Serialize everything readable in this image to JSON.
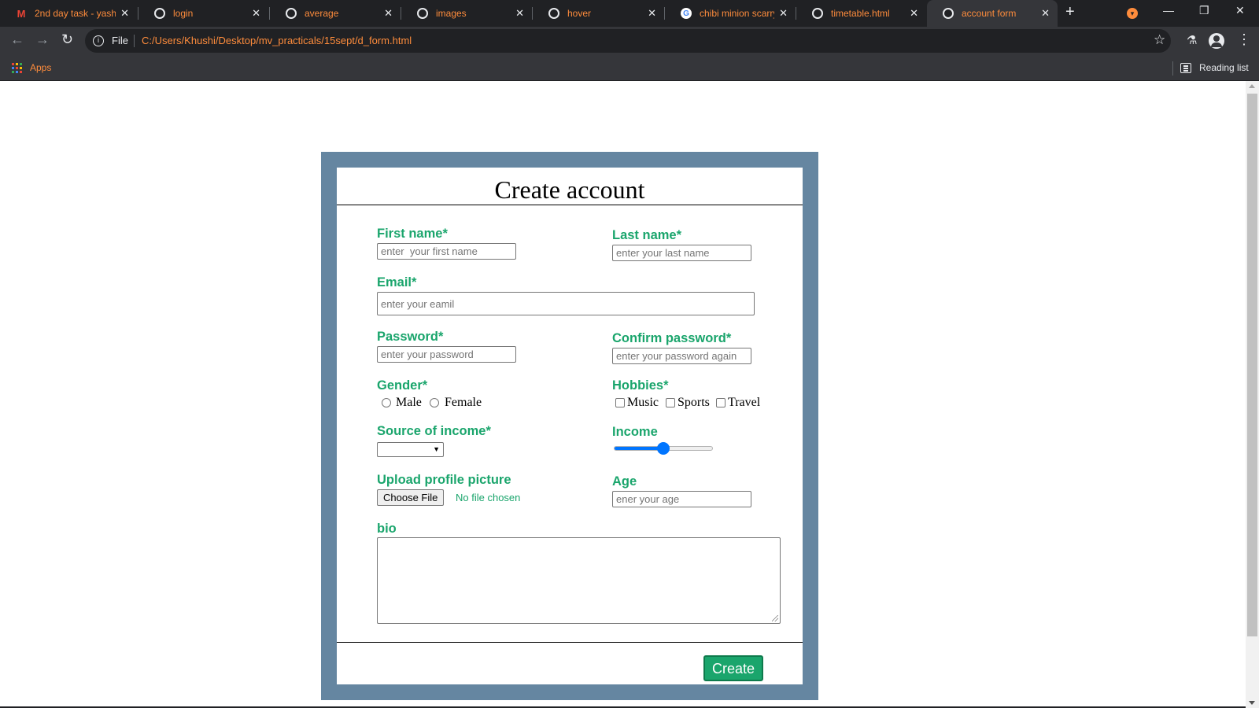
{
  "browser": {
    "tabs": [
      {
        "title": "2nd day task - yash",
        "icon": "gmail-icon"
      },
      {
        "title": "login",
        "icon": "globe-icon"
      },
      {
        "title": "average",
        "icon": "globe-icon"
      },
      {
        "title": "images",
        "icon": "globe-icon"
      },
      {
        "title": "hover",
        "icon": "globe-icon"
      },
      {
        "title": "chibi minion scarry",
        "icon": "google-icon"
      },
      {
        "title": "timetable.html",
        "icon": "globe-icon"
      },
      {
        "title": "account form",
        "icon": "globe-icon",
        "active": true
      }
    ],
    "address": {
      "scheme": "File",
      "url": "C:/Users/Khushi/Desktop/mv_practicals/15sept/d_form.html"
    },
    "bookmarks": {
      "apps_label": "Apps",
      "reading_list_label": "Reading list"
    },
    "accent_color": "#fe8c3c"
  },
  "form": {
    "title": "Create account",
    "label_color": "#1aa56c",
    "frame_color": "#6586a1",
    "first_name": {
      "label": "First name*",
      "placeholder": "enter  your first name"
    },
    "last_name": {
      "label": "Last name*",
      "placeholder": "enter your last name"
    },
    "email": {
      "label": "Email*",
      "placeholder": "enter your eamil"
    },
    "password": {
      "label": "Password*",
      "placeholder": "enter your password"
    },
    "confirm_password": {
      "label": "Confirm password*",
      "placeholder": "enter your password again"
    },
    "gender": {
      "label": "Gender*",
      "options": [
        "Male",
        "Female"
      ]
    },
    "hobbies": {
      "label": "Hobbies*",
      "options": [
        "Music",
        "Sports",
        "Travel"
      ]
    },
    "source_of_income": {
      "label": "Source of income*",
      "selected": ""
    },
    "income": {
      "label": "Income",
      "value_fraction": 0.5
    },
    "upload": {
      "label": "Upload profile picture",
      "button": "Choose File",
      "status": "No file chosen"
    },
    "age": {
      "label": "Age",
      "placeholder": "ener your age"
    },
    "bio": {
      "label": "bio"
    },
    "submit_label": "Create"
  }
}
